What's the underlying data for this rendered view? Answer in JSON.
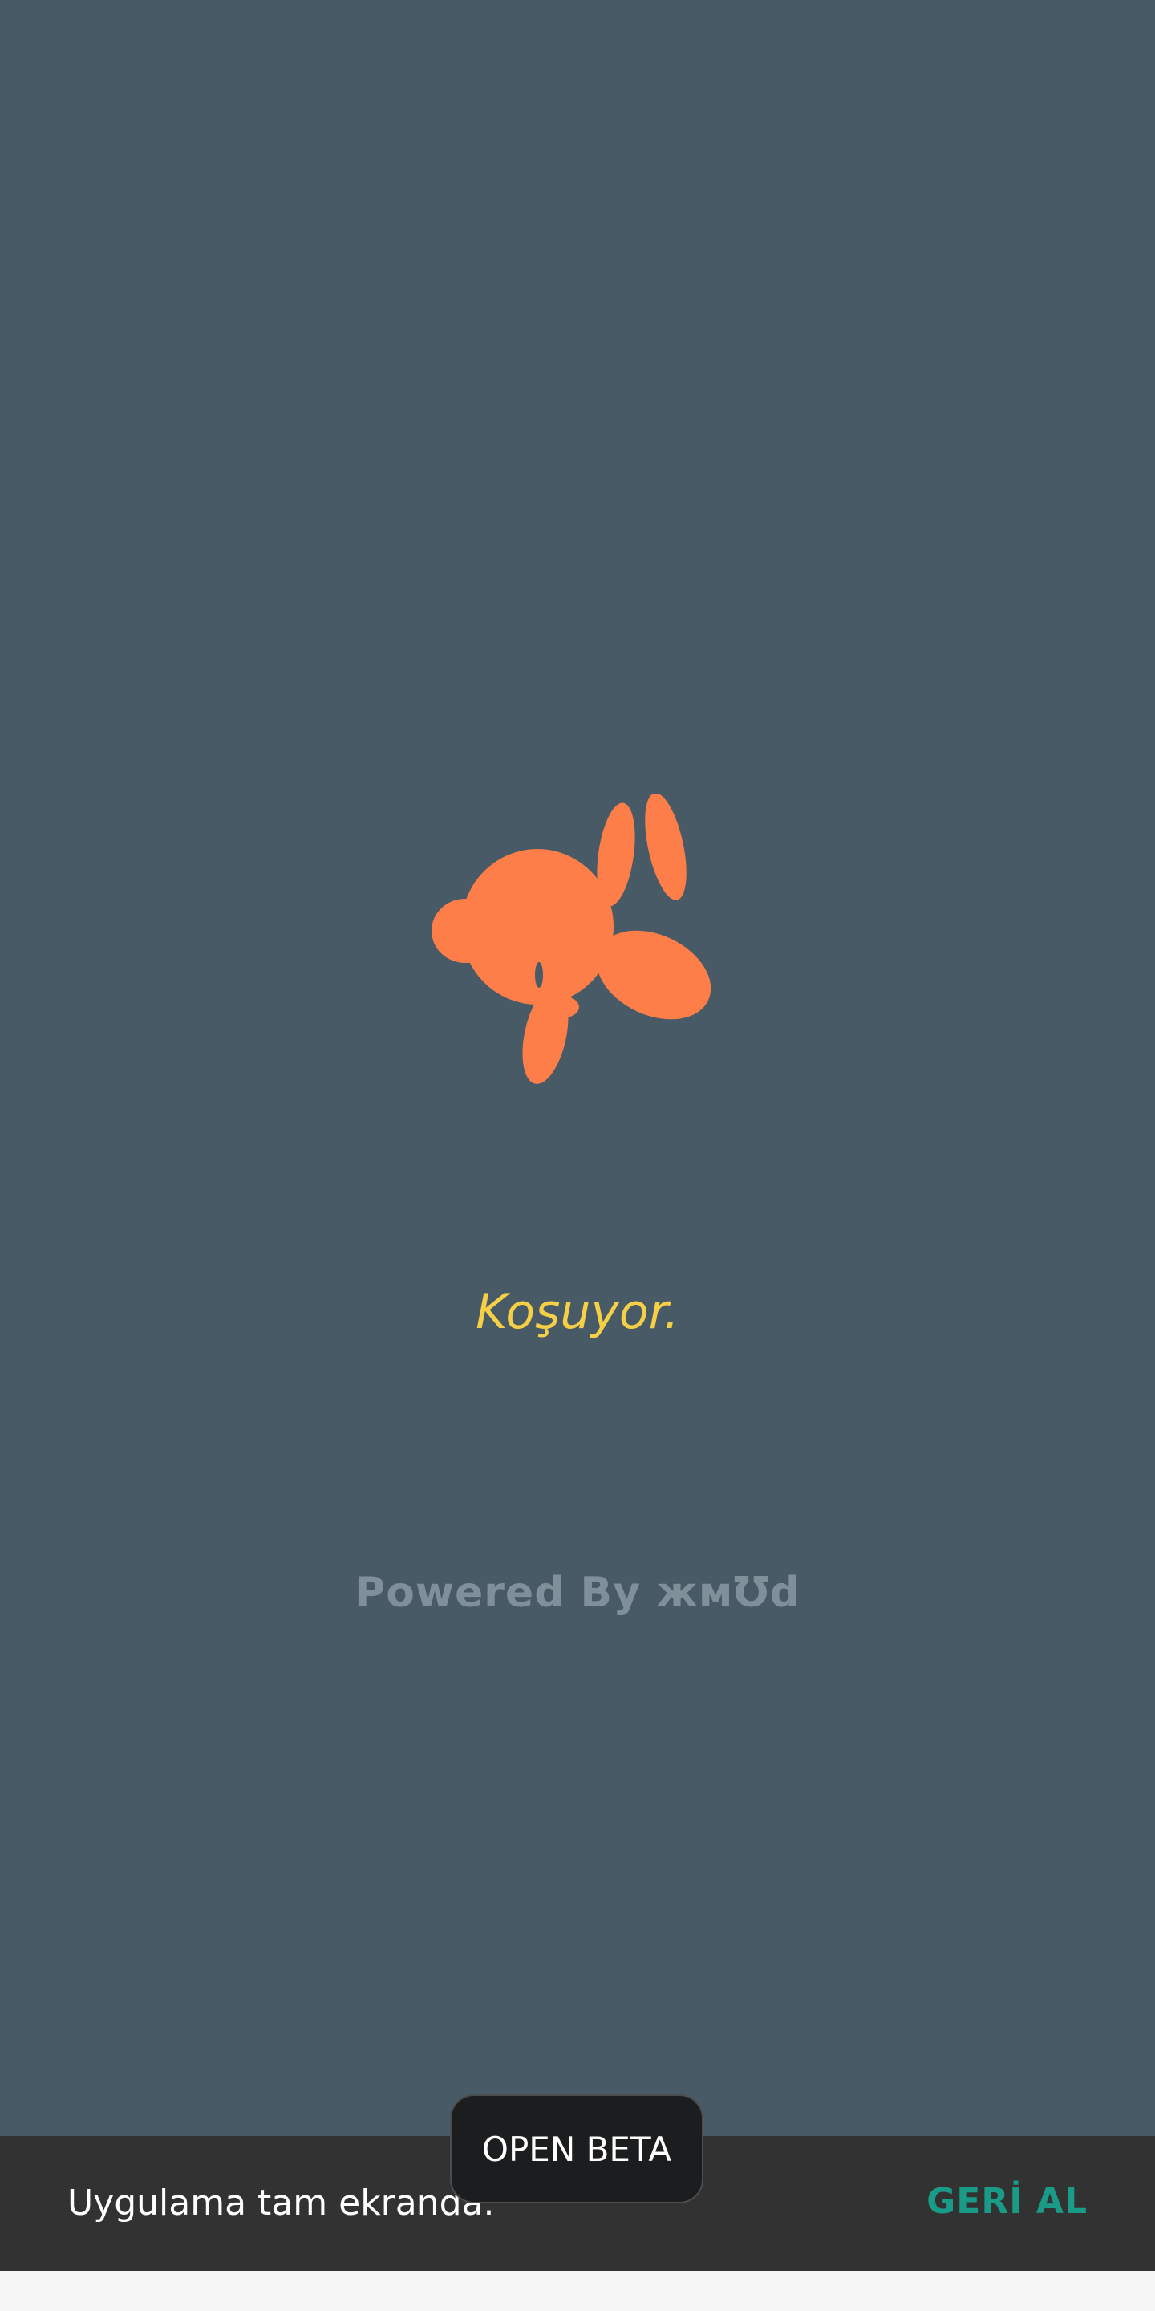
{
  "splash": {
    "logo_icon": "rabbit-icon",
    "status": "Koşuyor.",
    "powered_by": "Powered By жмƱd"
  },
  "snackbar": {
    "message": "Uygulama tam ekranda.",
    "action": "GERİ AL"
  },
  "badge": {
    "label": "OPEN BETA"
  },
  "colors": {
    "background": "#475a65",
    "logo": "#fd7e49",
    "status_text": "#f5cf45",
    "powered_text": "#7f909b",
    "snackbar_bg": "#323232",
    "action": "#1a9b87"
  }
}
